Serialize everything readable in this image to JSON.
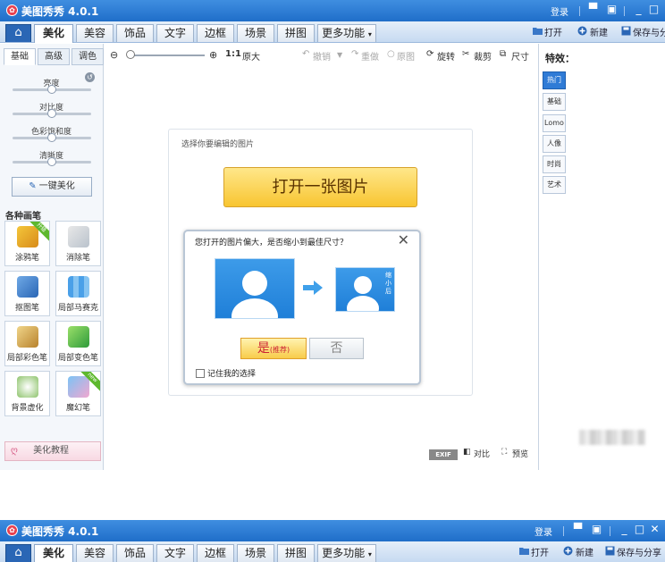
{
  "app": {
    "title": "美图秀秀 4.0.1",
    "login": "登录"
  },
  "menu_tabs": [
    {
      "label": "美化",
      "active": true
    },
    {
      "label": "美容"
    },
    {
      "label": "饰品"
    },
    {
      "label": "文字"
    },
    {
      "label": "边框"
    },
    {
      "label": "场景"
    },
    {
      "label": "拼图"
    },
    {
      "label": "更多功能"
    }
  ],
  "top_right": {
    "open": "打开",
    "new": "新建",
    "save": "保存与分享"
  },
  "side_tabs": [
    "基础",
    "高级",
    "调色"
  ],
  "sliders": [
    {
      "label": "亮度",
      "value": 0.5
    },
    {
      "label": "对比度",
      "value": 0.5
    },
    {
      "label": "色彩饱和度",
      "value": 0.5
    },
    {
      "label": "清晰度",
      "value": 0.5
    }
  ],
  "one_click": "一键美化",
  "brushes_title": "各种画笔",
  "tools": [
    {
      "label": "涂鸦笔",
      "badge": "升级"
    },
    {
      "label": "消除笔"
    },
    {
      "label": "抠图笔"
    },
    {
      "label": "局部马赛克"
    },
    {
      "label": "局部彩色笔"
    },
    {
      "label": "局部变色笔"
    },
    {
      "label": "背景虚化"
    },
    {
      "label": "魔幻笔",
      "badge": "new"
    }
  ],
  "tutorial": "美化教程",
  "toolbar": {
    "zoom_1to1": "1:1",
    "zoom_orig": "原大",
    "undo": "撤销",
    "redo": "重做",
    "original": "原图",
    "rotate": "旋转",
    "crop": "裁剪",
    "size": "尺寸"
  },
  "canvas": {
    "prompt": "选择你要编辑的图片",
    "open_btn": "打开一张图片"
  },
  "dialog": {
    "title": "您打开的图片偏大，是否缩小到最佳尺寸？",
    "shrink": "缩小后",
    "yes": "是",
    "yes_hint": "(推荐)",
    "no": "否",
    "remember": "记住我的选择"
  },
  "effects": {
    "title": "特效：",
    "tabs": [
      "热门",
      "基础",
      "Lomo",
      "人像",
      "时尚",
      "艺术"
    ]
  },
  "status": {
    "exif": "EXIF",
    "compare": "对比",
    "preview": "预览"
  },
  "colors": {
    "accent": "#2f7bd6",
    "title_bar": "#1f6ec9",
    "open_btn": "#f8c531"
  }
}
